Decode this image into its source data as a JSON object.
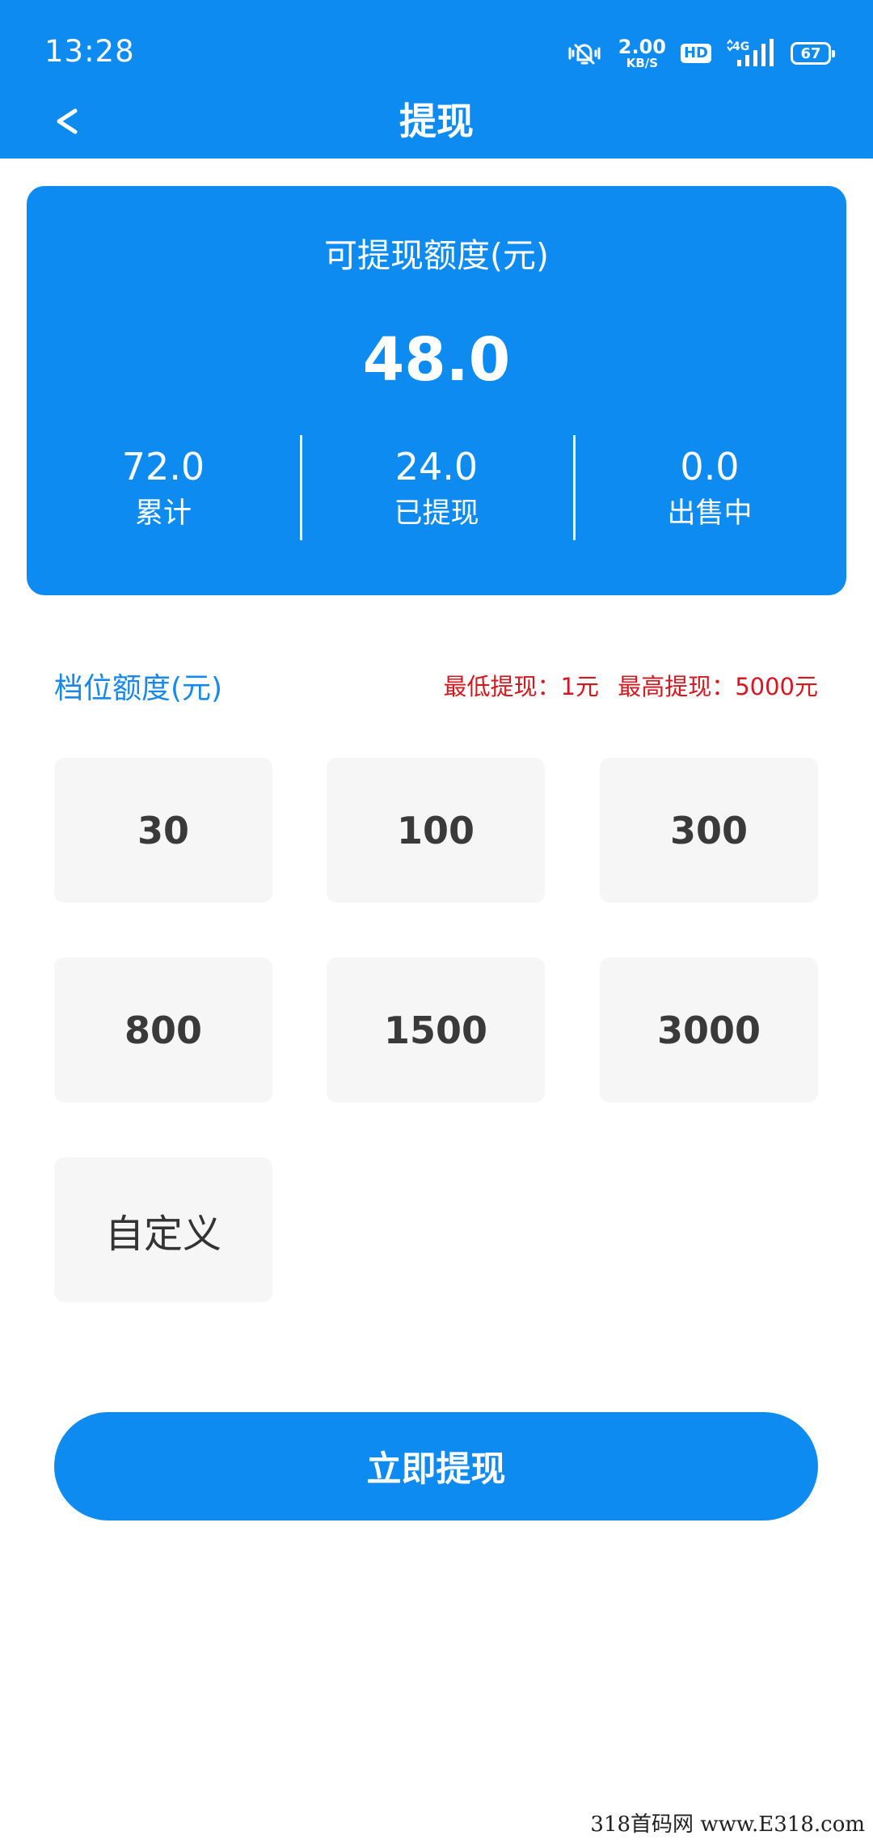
{
  "status_bar": {
    "time": "13:28",
    "net_speed_value": "2.00",
    "net_speed_unit": "KB/S",
    "hd_badge": "HD",
    "network": "4G",
    "battery": "67"
  },
  "nav": {
    "back_label": "<",
    "title": "提现"
  },
  "summary": {
    "label": "可提现额度(元)",
    "amount": "48.0",
    "stats": [
      {
        "value": "72.0",
        "label": "累计"
      },
      {
        "value": "24.0",
        "label": "已提现"
      },
      {
        "value": "0.0",
        "label": "出售中"
      }
    ]
  },
  "tiers": {
    "title": "档位额度(元)",
    "min_note": "最低提现：1元",
    "max_note": "最高提现：5000元",
    "options": [
      "30",
      "100",
      "300",
      "800",
      "1500",
      "3000",
      "自定义"
    ]
  },
  "actions": {
    "withdraw_label": "立即提现"
  },
  "watermark": "318首码网 www.E318.com",
  "colors": {
    "primary": "#0d8bf0",
    "tier_bg": "#f6f6f6",
    "limit_red": "#d7171f",
    "section_blue": "#1889e8"
  }
}
